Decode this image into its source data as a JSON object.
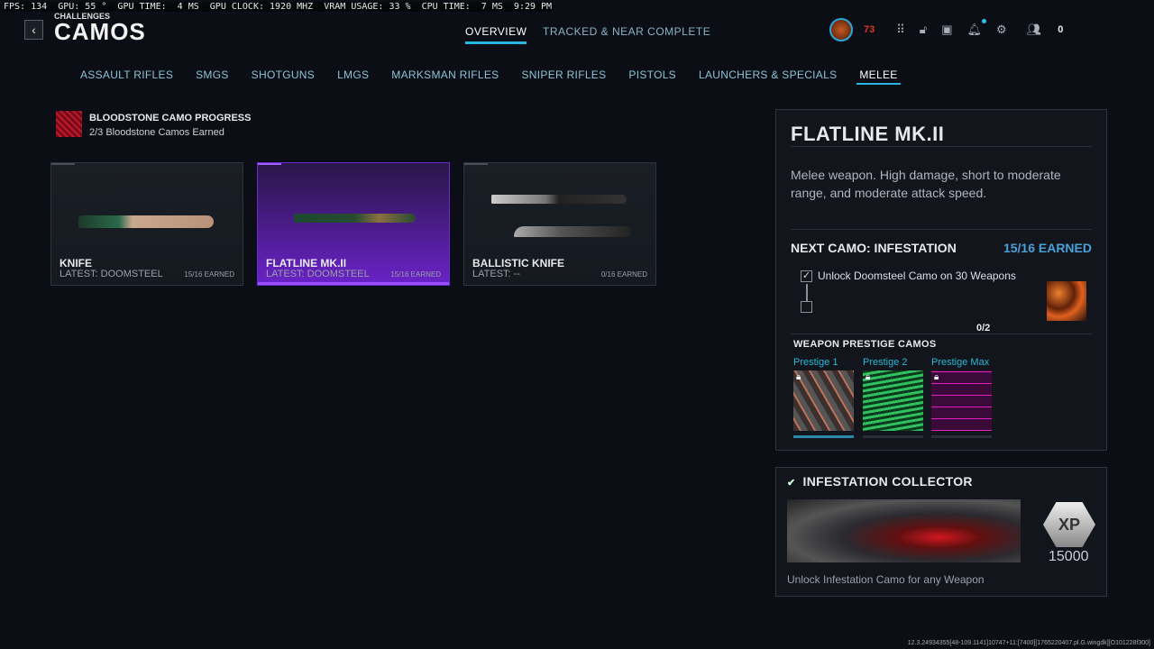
{
  "perf": "FPS: 134  GPU: 55 °  GPU TIME:  4 MS  GPU CLOCK: 1920 MHZ  VRAM USAGE: 33 %  CPU TIME:  7 MS  9:29 PM",
  "header": {
    "breadcrumb": "CHALLENGES",
    "title": "CAMOS",
    "tabs": [
      {
        "label": "OVERVIEW"
      },
      {
        "label": "TRACKED & NEAR COMPLETE"
      }
    ]
  },
  "hud": {
    "level": "73",
    "currency": "0",
    "icons": [
      "avatar",
      "grid-icon",
      "unlock-icon",
      "store-icon",
      "bell-icon",
      "gear-icon",
      "party-icon"
    ]
  },
  "categories": [
    "ASSAULT RIFLES",
    "SMGS",
    "SHOTGUNS",
    "LMGS",
    "MARKSMAN RIFLES",
    "SNIPER RIFLES",
    "PISTOLS",
    "LAUNCHERS & SPECIALS",
    "MELEE"
  ],
  "progress": {
    "title": "BLOODSTONE CAMO PROGRESS",
    "subtitle": "2/3 Bloodstone Camos Earned"
  },
  "weapons": [
    {
      "name": "KNIFE",
      "latest": "LATEST: DOOMSTEEL",
      "earned": "15/16 EARNED"
    },
    {
      "name": "FLATLINE MK.II",
      "latest": "LATEST: DOOMSTEEL",
      "earned": "15/16 EARNED"
    },
    {
      "name": "BALLISTIC KNIFE",
      "latest": "LATEST: --",
      "earned": "0/16 EARNED"
    }
  ],
  "detail": {
    "name": "FLATLINE MK.II",
    "description": "Melee weapon. High damage, short to moderate range, and moderate attack speed.",
    "next_camo": "NEXT CAMO: INFESTATION",
    "next_earned": "15/16 EARNED",
    "task": "Unlock Doomsteel Camo on 30 Weapons",
    "task_count": "0/2",
    "prestige_heading": "WEAPON PRESTIGE CAMOS",
    "prestige": [
      {
        "label": "Prestige 1"
      },
      {
        "label": "Prestige 2"
      },
      {
        "label": "Prestige Max"
      }
    ]
  },
  "collector": {
    "title": "INFESTATION COLLECTOR",
    "xp": "15000",
    "xp_badge": "XP",
    "description": "Unlock Infestation Camo for any Weapon"
  },
  "build": "12.3.24934355[48-109.1141]10747+11:[7400][1765220407.pl.G.wingdk][O101228f300]"
}
